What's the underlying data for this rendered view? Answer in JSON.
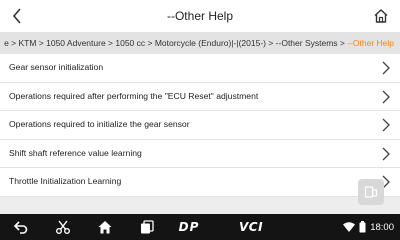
{
  "header": {
    "title": "--Other Help"
  },
  "breadcrumb": {
    "path": "e > KTM > 1050 Adventure > 1050 cc > Motorcycle (Enduro)|-|(2015-) > --Other Systems > ",
    "current": "--Other Help"
  },
  "items": [
    {
      "label": "Gear sensor initialization"
    },
    {
      "label": "Operations required after performing the \"ECU Reset\" adjustment"
    },
    {
      "label": "Operations required to initialize the gear sensor"
    },
    {
      "label": "Shift shaft reference value learning"
    },
    {
      "label": "Throttle Initialization Learning"
    }
  ],
  "navbar": {
    "dp_logo": "DP",
    "vci_logo": "VCI",
    "time": "18:00"
  },
  "icons": {
    "back": "chevron-left-icon",
    "home": "home-icon",
    "row_chevron": "chevron-right-icon",
    "float": "screen-icon",
    "back_nav": "back-nav-icon",
    "scissors": "scissors-icon",
    "home_nav": "home-nav-icon",
    "recents": "recent-apps-icon",
    "wifi": "wifi-icon",
    "battery": "battery-icon"
  },
  "colors": {
    "accent": "#f08a1c",
    "navbar": "#141414",
    "header": "#ffffff",
    "breadcrumb_bg": "#e3e3e3"
  }
}
